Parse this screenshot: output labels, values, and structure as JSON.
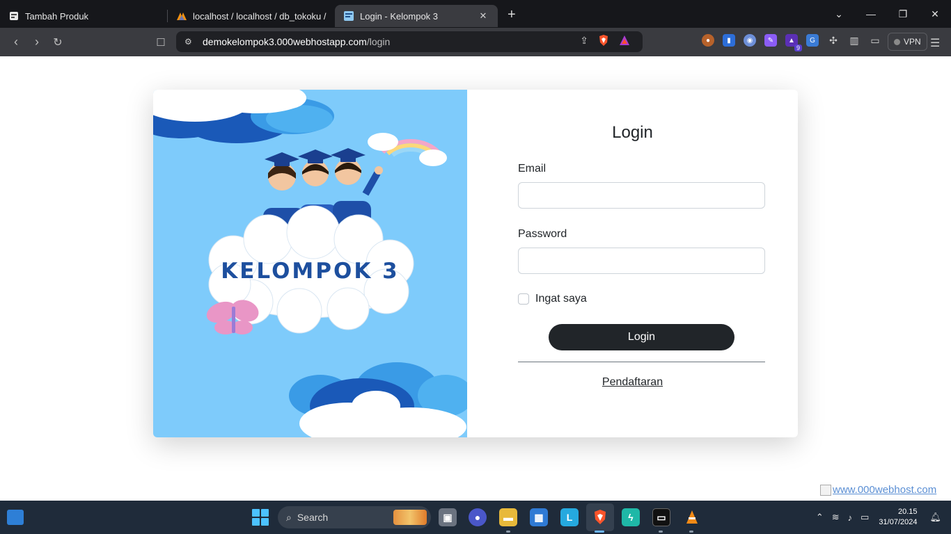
{
  "browser": {
    "tabs": [
      {
        "title": "Tambah Produk",
        "active": false
      },
      {
        "title": "localhost / localhost / db_tokoku / u",
        "active": false
      },
      {
        "title": "Login - Kelompok 3",
        "active": true
      }
    ],
    "new_tab": "+",
    "url_host": "demokelompok3.000webhostapp.com",
    "url_path": "/login",
    "vpn_label": "VPN",
    "extension_badge": "9"
  },
  "page": {
    "hero": {
      "title": "KELOMPOK 3",
      "colors": {
        "sky": "#7ecbfb",
        "cloud_dark": "#1a59b8",
        "text": "#1d4f9e"
      }
    },
    "login": {
      "heading": "Login",
      "email_label": "Email",
      "email_value": "",
      "password_label": "Password",
      "password_value": "",
      "remember_label": "Ingat saya",
      "submit_label": "Login",
      "register_link": "Pendaftaran"
    },
    "footer_image_alt": "www.000webhost.com"
  },
  "taskbar": {
    "search_placeholder": "Search",
    "time": "20.15",
    "date": "31/07/2024"
  }
}
